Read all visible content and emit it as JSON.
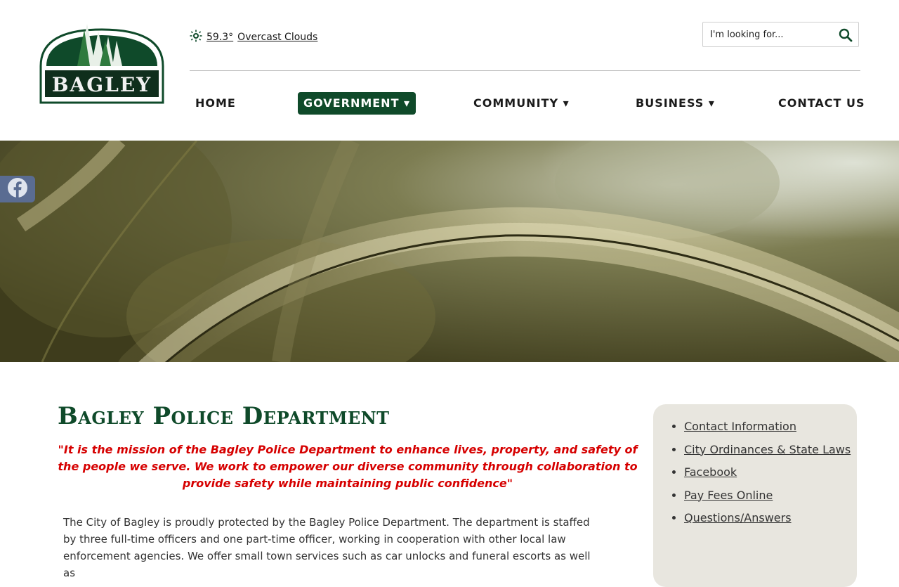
{
  "logo": {
    "text": "BAGLEY"
  },
  "weather": {
    "icon": "weather-sun-icon",
    "temp": "59.3°",
    "condition": "Overcast Clouds"
  },
  "search": {
    "placeholder": "I'm looking for..."
  },
  "nav": [
    {
      "label": "HOME",
      "active": false
    },
    {
      "label": "GOVERNMENT ▾",
      "active": true
    },
    {
      "label": "COMMUNITY ▾",
      "active": false
    },
    {
      "label": "BUSINESS ▾",
      "active": false
    },
    {
      "label": "CONTACT US",
      "active": false
    }
  ],
  "social": {
    "facebook_icon": "facebook-icon"
  },
  "page": {
    "title": "Bagley Police Department",
    "mission": "\"It is the mission of the Bagley Police Department to enhance lives, property, and safety of the people we serve. We work to empower our diverse community through collaboration to provide safety while maintaining public confidence\"",
    "body": "The City of Bagley is proudly protected by the Bagley Police Department. The department is staffed by three full-time officers and one part-time officer, working in cooperation with other local law enforcement agencies. We offer small town services such as car unlocks and funeral escorts as well as"
  },
  "sidebar": {
    "links": [
      "Contact Information",
      "City Ordinances & State Laws",
      "Facebook",
      "Pay Fees Online",
      "Questions/Answers"
    ]
  },
  "colors": {
    "brand_green": "#0f4a2a",
    "mission_red": "#d60000",
    "sidebar_bg": "#e8e6df"
  }
}
